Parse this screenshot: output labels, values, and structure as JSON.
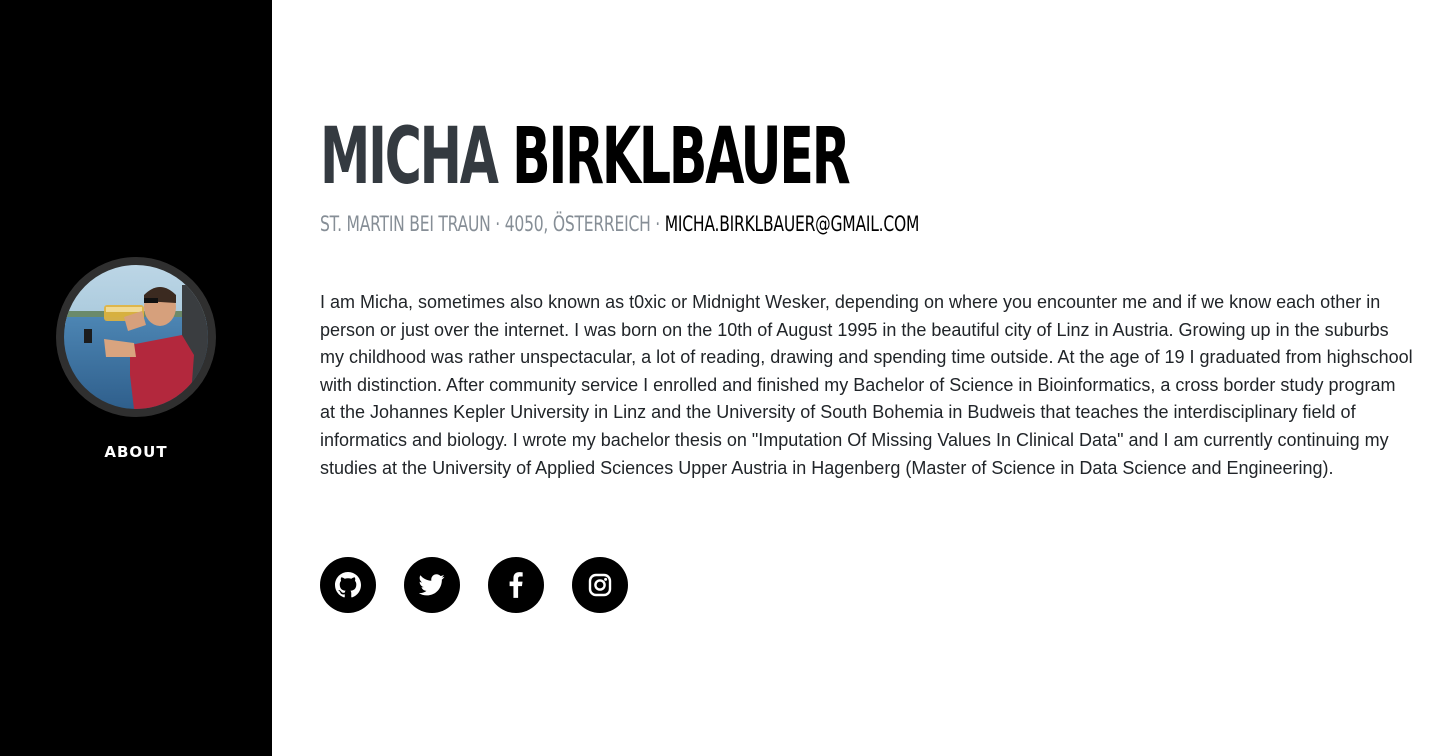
{
  "sidebar": {
    "nav_about": "ABOUT"
  },
  "header": {
    "first_name": "MICHA",
    "last_name": "BIRKLBAUER",
    "address": "ST. MARTIN BEI TRAUN · 4050, ÖSTERREICH · ",
    "email": "MICHA.BIRKLBAUER@GMAIL.COM"
  },
  "bio": "I am Micha, sometimes also known as t0xic or Midnight Wesker, depending on where you encounter me and if we know each other in person or just over the internet. I was born on the 10th of August 1995 in the beautiful city of Linz in Austria. Growing up in the suburbs my childhood was rather unspectacular, a lot of reading, drawing and spending time outside. At the age of 19 I graduated from highschool with distinction. After community service I enrolled and finished my Bachelor of Science in Bioinformatics, a cross border study program at the Johannes Kepler University in Linz and the University of South Bohemia in Budweis that teaches the interdisciplinary field of informatics and biology. I wrote my bachelor thesis on \"Imputation Of Missing Values In Clinical Data\" and I am currently continuing my studies at the University of Applied Sciences Upper Austria in Hagenberg (Master of Science in Data Science and Engineering).",
  "social": [
    {
      "icon": "github-icon"
    },
    {
      "icon": "twitter-icon"
    },
    {
      "icon": "facebook-icon"
    },
    {
      "icon": "instagram-icon"
    }
  ],
  "colors": {
    "sidebar_bg": "#000000",
    "first_name": "#343a40",
    "address": "#868e96",
    "text": "#212529"
  }
}
